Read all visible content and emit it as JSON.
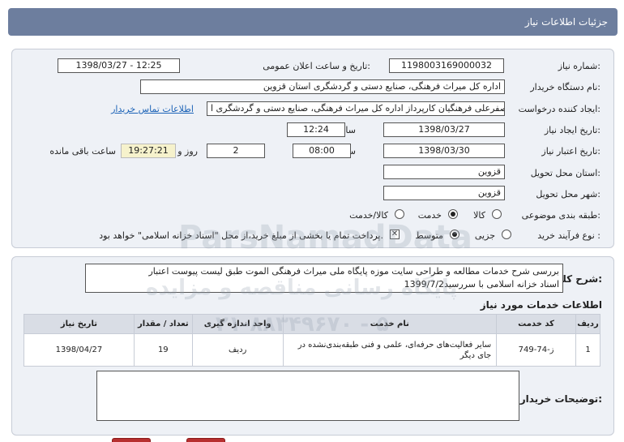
{
  "header": {
    "title": "جزئیات اطلاعات نیاز"
  },
  "form": {
    "need_number_label": "شماره نیاز:",
    "need_number": "1198003169000032",
    "announce_label": "تاریخ و ساعت اعلان عمومی:",
    "announce_value": "1398/03/27 - 12:25",
    "buyer_label": "نام دستگاه خریدار:",
    "buyer_value": "اداره کل میراث فرهنگی، صنایع دستی و گردشگری استان قزوین",
    "requester_label": "ایجاد کننده درخواست:",
    "requester_value": "صفرعلی فرهنگیان کارپرداز اداره کل میراث فرهنگی، صنایع دستی و گردشگری ا",
    "contact_link": "اطلاعات تماس خریدار",
    "created_label": "تاریخ ایجاد نیاز:",
    "created_date": "1398/03/27",
    "time_word": "ساعت",
    "created_time": "12:24",
    "validity_label": "تاریخ اعتبار نیاز:",
    "validity_date": "1398/03/30",
    "validity_time": "08:00",
    "days_value": "2",
    "days_word": "روز و",
    "remaining_time": "19:27:21",
    "remaining_word": "ساعت باقی مانده",
    "province_label": "استان محل تحویل:",
    "province_value": "قزوین",
    "city_label": "شهر محل تحویل:",
    "city_value": "قزوین",
    "category_label": "طبقه بندی موضوعی:",
    "category_options": [
      "کالا",
      "خدمت",
      "کالا/خدمت"
    ],
    "category_selected": "خدمت",
    "process_label": "نوع فرآیند خرید :",
    "process_options": [
      "جزیی",
      "متوسط"
    ],
    "process_selected": "متوسط",
    "payment_note": "پرداخت تمام یا بخشی از مبلغ خرید،از محل \"اسناد خزانه اسلامی\" خواهد بود."
  },
  "description": {
    "label": "شرح کلی نیاز:",
    "text_line1": "بررسی شرح خدمات مطالعه و طراحی سایت موزه پایگاه ملی میراث فرهنگی الموت طبق لیست پیوست اعتبار",
    "text_line2": "اسناد خزانه اسلامی با سررسید1399/7/2"
  },
  "services": {
    "title": "اطلاعات خدمات مورد نیاز",
    "columns": [
      "ردیف",
      "کد خدمت",
      "نام خدمت",
      "واحد اندازه گیری",
      "تعداد / مقدار",
      "تاریخ نیاز"
    ],
    "rows": [
      {
        "row": "1",
        "code": "ز-74-749",
        "name": "سایر فعالیت‌های حرفه‌ای، علمی و فنی طبقه‌بندی‌نشده در جای دیگر",
        "unit": "ردیف",
        "qty": "19",
        "date": "1398/04/27"
      }
    ]
  },
  "buyer_notes": {
    "label": "توضیحات خریدار:",
    "value": ""
  },
  "watermark": {
    "line1": "ParsNamadData",
    "line2": "پایگاه رسانی مناقصه و مزایده",
    "line3": "۰۲۱-۸۸۳۴۹۶۷۰ - ۵"
  },
  "colors": {
    "header": "#6d7e9e",
    "panel": "#eef1f6",
    "link": "#1c63b7",
    "remaining_bg": "#f6f2cc"
  }
}
